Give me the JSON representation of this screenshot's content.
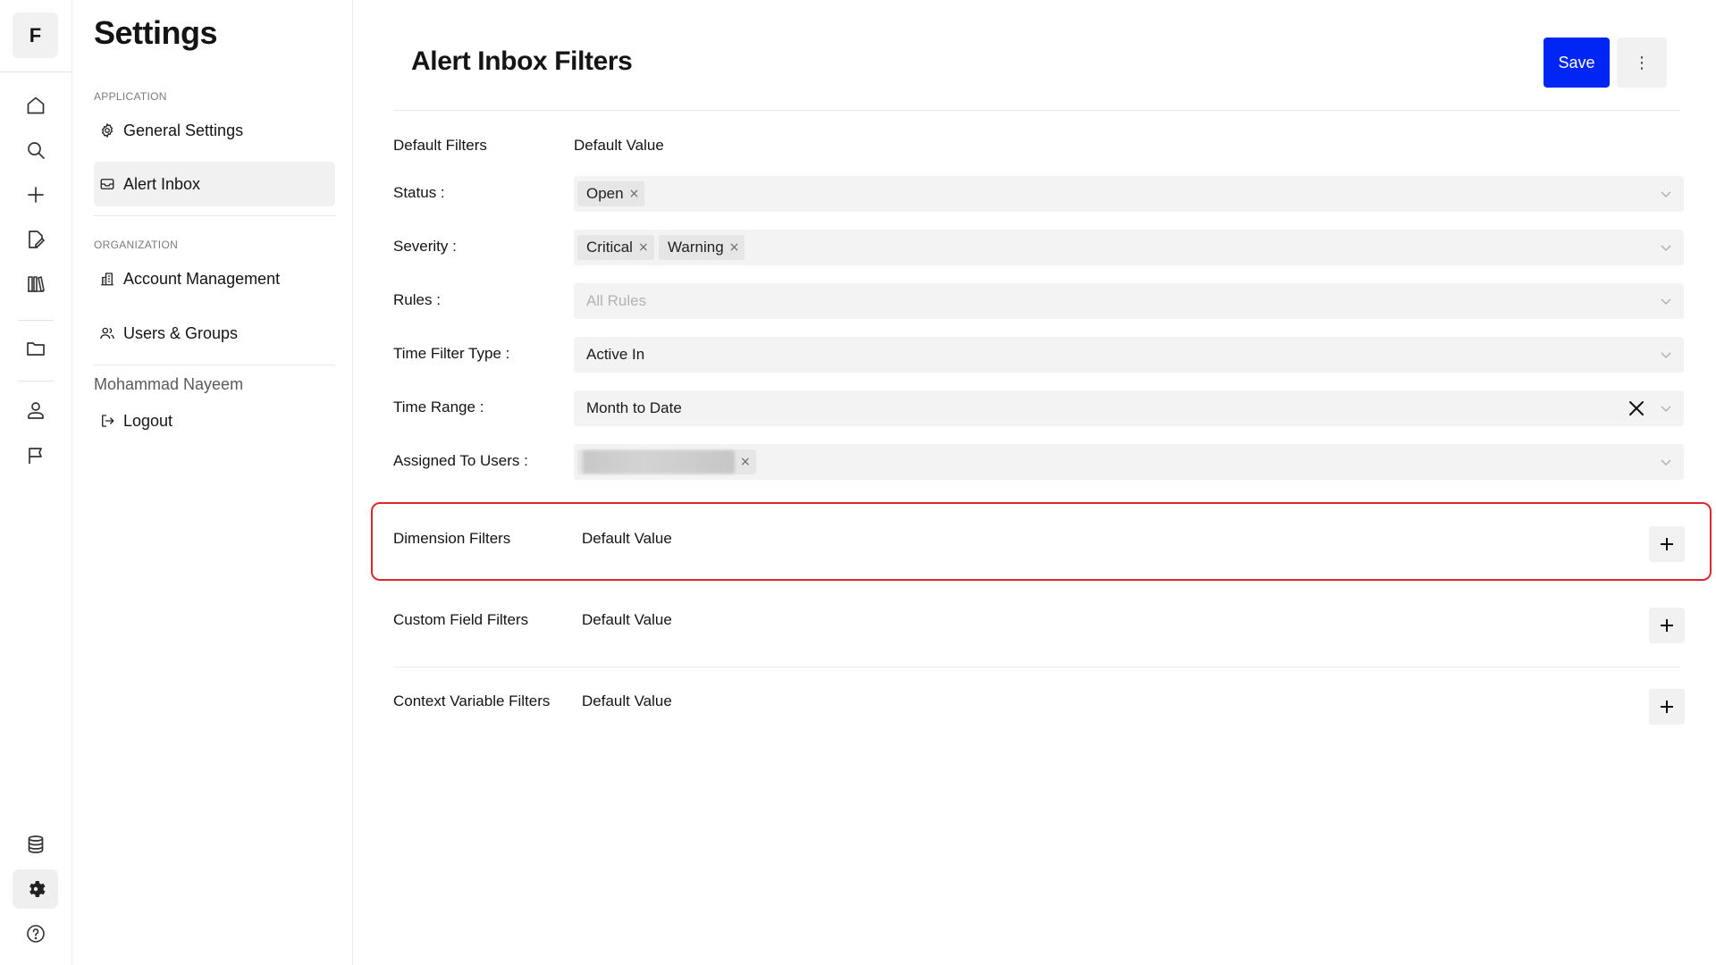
{
  "rail": {
    "logo_letter": "F",
    "items": [
      {
        "name": "home-icon"
      },
      {
        "name": "search-icon"
      },
      {
        "name": "plus-icon"
      },
      {
        "name": "edit-document-icon"
      },
      {
        "name": "library-icon"
      },
      {
        "name": "folder-icon"
      },
      {
        "name": "user-icon"
      },
      {
        "name": "flag-icon"
      },
      {
        "name": "database-icon"
      },
      {
        "name": "gear-icon",
        "active": true
      },
      {
        "name": "help-icon"
      }
    ]
  },
  "sidebar": {
    "title": "Settings",
    "sections": [
      {
        "label": "APPLICATION",
        "items": [
          {
            "label": "General Settings",
            "icon": "gear-icon"
          },
          {
            "label": "Alert Inbox",
            "icon": "inbox-icon",
            "active": true
          }
        ]
      },
      {
        "label": "ORGANIZATION",
        "items": [
          {
            "label": "Account Management",
            "icon": "building-icon"
          },
          {
            "label": "Users & Groups",
            "icon": "users-icon"
          }
        ]
      }
    ],
    "user_name": "Mohammad Nayeem",
    "logout_label": "Logout"
  },
  "main": {
    "title": "Alert Inbox Filters",
    "save_label": "Save",
    "more_label": "⋮",
    "default_filters": {
      "heading": "Default Filters",
      "value_heading": "Default Value",
      "rows": [
        {
          "label": "Status",
          "tags": [
            "Open"
          ]
        },
        {
          "label": "Severity",
          "tags": [
            "Critical",
            "Warning"
          ]
        },
        {
          "label": "Rules",
          "placeholder": "All Rules"
        },
        {
          "label": "Time Filter Type",
          "value": "Active In"
        },
        {
          "label": "Time Range",
          "value": "Month to Date"
        },
        {
          "label": "Assigned To Users",
          "tags_redacted": 1
        }
      ]
    },
    "sections": [
      {
        "label": "Dimension Filters",
        "value_heading": "Default Value",
        "highlighted": true
      },
      {
        "label": "Custom Field Filters",
        "value_heading": "Default Value"
      },
      {
        "label": "Context Variable Filters",
        "value_heading": "Default Value"
      }
    ],
    "highlight_color": "#e0262d",
    "accent_color": "#0025f5"
  }
}
